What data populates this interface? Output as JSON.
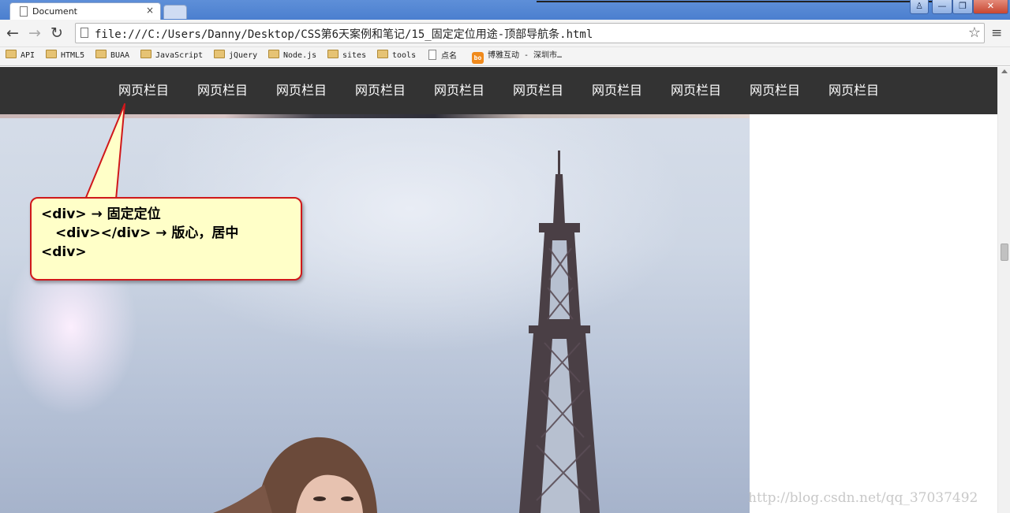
{
  "browser": {
    "tab_title": "Document",
    "tab_close": "×",
    "url": "file:///C:/Users/Danny/Desktop/CSS第6天案例和笔记/15_固定定位用途-顶部导航条.html",
    "window_buttons": {
      "user": "♙",
      "minimize": "—",
      "maximize": "❐",
      "close": "✕"
    },
    "nav": {
      "back": "←",
      "forward": "→",
      "reload": "↻",
      "star": "☆",
      "menu": "≡"
    }
  },
  "bookmarks": [
    {
      "label": "API",
      "icon": "folder-icon"
    },
    {
      "label": "HTML5",
      "icon": "folder-icon"
    },
    {
      "label": "BUAA",
      "icon": "folder-icon"
    },
    {
      "label": "JavaScript",
      "icon": "folder-icon"
    },
    {
      "label": "jQuery",
      "icon": "folder-icon"
    },
    {
      "label": "Node.js",
      "icon": "folder-icon"
    },
    {
      "label": "sites",
      "icon": "folder-icon"
    },
    {
      "label": "tools",
      "icon": "folder-icon"
    },
    {
      "label": "点名",
      "icon": "page-icon"
    },
    {
      "label": "博雅互动 - 深圳市…",
      "icon": "boyaa-icon",
      "badge": "bo"
    }
  ],
  "page": {
    "nav_items": [
      "网页栏目",
      "网页栏目",
      "网页栏目",
      "网页栏目",
      "网页栏目",
      "网页栏目",
      "网页栏目",
      "网页栏目",
      "网页栏目",
      "网页栏目"
    ],
    "callout": {
      "line1": "<div>  → 固定定位",
      "line2": "<div></div>  → 版心，居中",
      "line3": "<div>"
    },
    "watermark": "http://blog.csdn.net/qq_37037492"
  },
  "colors": {
    "nav_bg": "#333333",
    "callout_bg": "#ffffc8",
    "callout_border": "#d0181b",
    "titlebar": "#5e8fd8"
  }
}
